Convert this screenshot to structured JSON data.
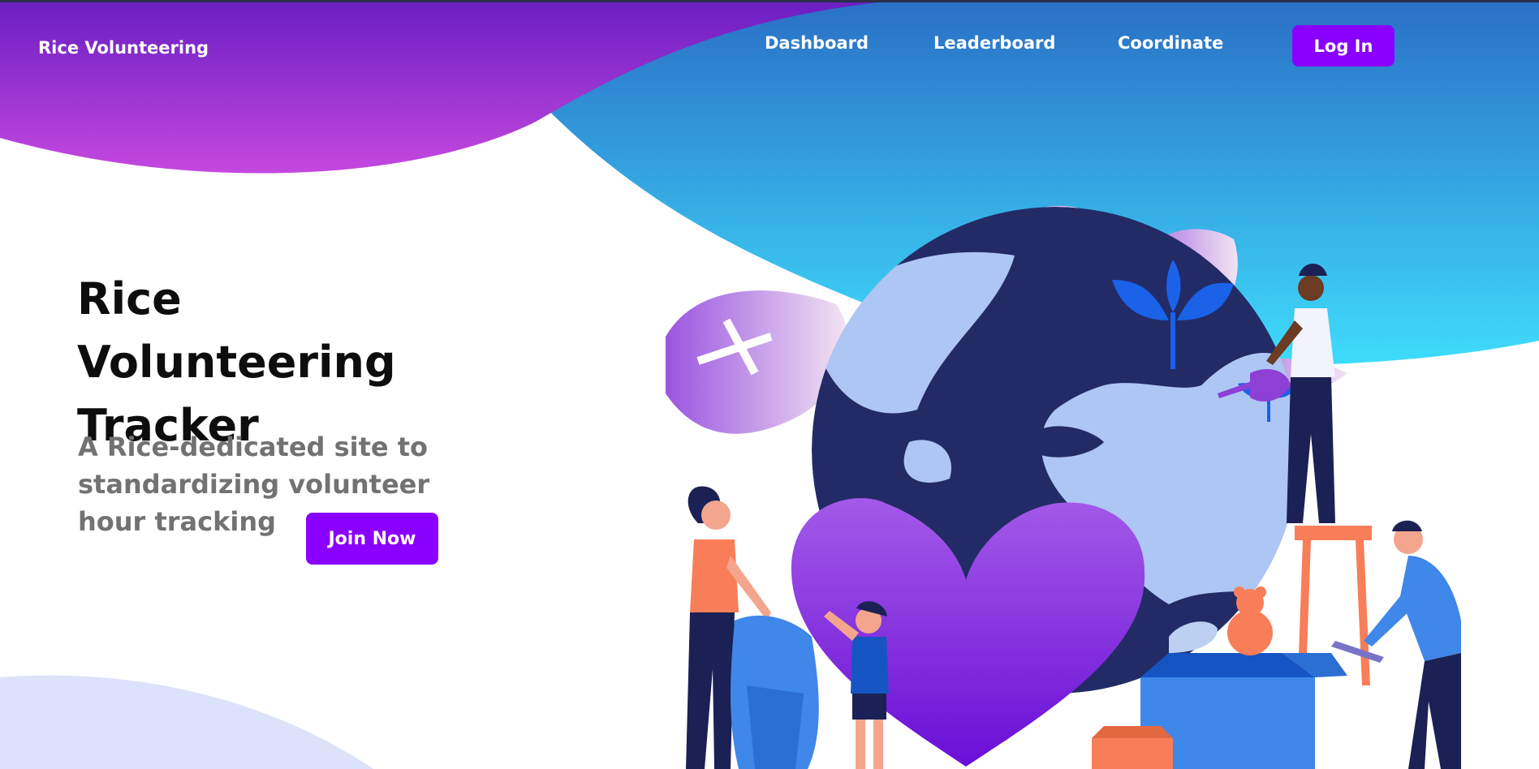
{
  "brand": "Rice Volunteering",
  "nav": {
    "links": [
      "Dashboard",
      "Leaderboard",
      "Coordinate"
    ],
    "login_label": "Log In"
  },
  "hero": {
    "title": "Rice Volunteering Tracker",
    "subtitle": "A Rice-dedicated site to standardizing volunteer hour tracking",
    "cta_label": "Join Now"
  },
  "colors": {
    "accent": "#8a00ff",
    "wave_purple_top": "#6b1fc4",
    "wave_purple_bottom": "#c246e0",
    "wave_blue_top": "#2a74c8",
    "wave_blue_bottom": "#3fd6f8"
  }
}
